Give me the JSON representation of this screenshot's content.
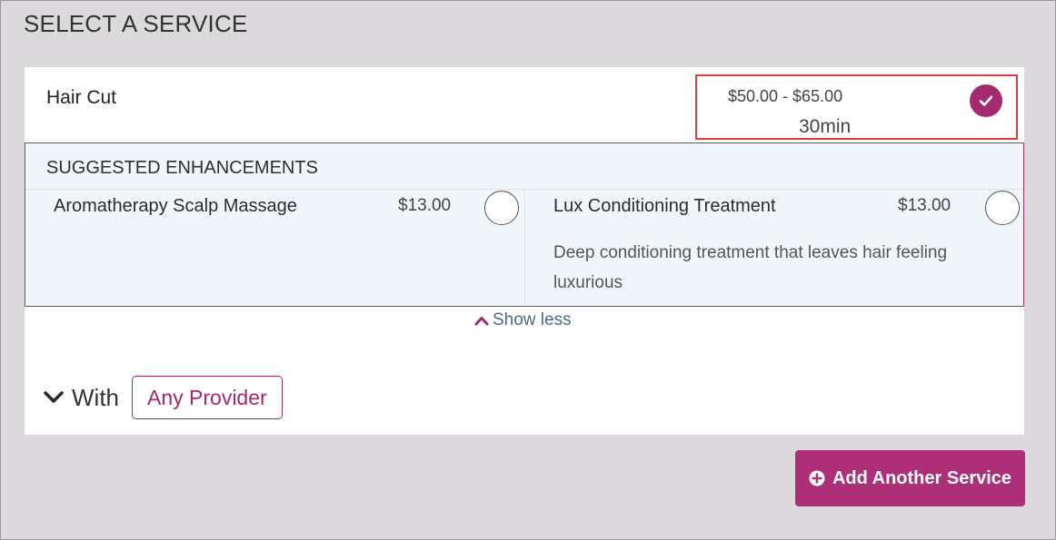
{
  "page": {
    "title": "SELECT A SERVICE"
  },
  "service": {
    "name": "Hair Cut",
    "price_range": "$50.00 - $65.00",
    "duration": "30min",
    "selected": true,
    "check_icon": "checkmark-icon"
  },
  "enhancements": {
    "title": "SUGGESTED ENHANCEMENTS",
    "items": [
      {
        "name": "Aromatherapy Scalp Massage",
        "price": "$13.00",
        "description": "",
        "selected": false
      },
      {
        "name": "Lux Conditioning Treatment",
        "price": "$13.00",
        "description": "Deep conditioning treatment that leaves hair feeling luxurious",
        "selected": false
      }
    ],
    "toggle_label": "Show less",
    "toggle_icon": "chevron-up-icon"
  },
  "provider": {
    "expand_icon": "chevron-down-icon",
    "with_label": "With",
    "button_label": "Any Provider"
  },
  "actions": {
    "add_service_label": "Add Another Service",
    "add_icon": "plus-circle-icon"
  },
  "colors": {
    "accent": "#ad2f78",
    "highlight_border": "#d9403a",
    "link": "#4a6a8a",
    "background": "#dcd9dc",
    "enhancement_bg": "#f1f6fa"
  }
}
